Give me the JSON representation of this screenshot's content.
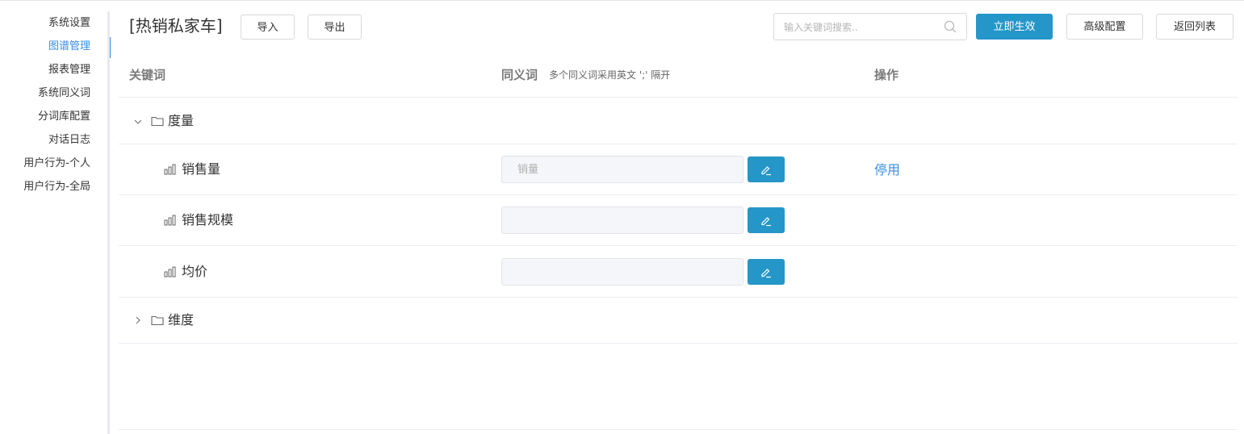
{
  "sidebar": {
    "items": [
      {
        "label": "系统设置",
        "active": false
      },
      {
        "label": "图谱管理",
        "active": true
      },
      {
        "label": "报表管理",
        "active": false
      },
      {
        "label": "系统同义词",
        "active": false
      },
      {
        "label": "分词库配置",
        "active": false
      },
      {
        "label": "对话日志",
        "active": false
      },
      {
        "label": "用户行为-个人",
        "active": false
      },
      {
        "label": "用户行为-全局",
        "active": false
      }
    ]
  },
  "header": {
    "title": "[热销私家车]",
    "import_label": "导入",
    "export_label": "导出",
    "search_placeholder": "输入关键词搜索..",
    "apply_label": "立即生效",
    "advanced_label": "高级配置",
    "back_label": "返回列表"
  },
  "table": {
    "columns": {
      "keyword": "关键词",
      "synonym": "同义词",
      "synonym_hint": "多个同义词采用英文 ';' 隔开",
      "ops": "操作"
    },
    "groups": [
      {
        "label": "度量",
        "expanded": true,
        "items": [
          {
            "label": "销售量",
            "synonym_value": "",
            "synonym_placeholder": "销量",
            "op": "停用"
          },
          {
            "label": "销售规模",
            "synonym_value": "",
            "synonym_placeholder": "",
            "op": ""
          },
          {
            "label": "均价",
            "synonym_value": "",
            "synonym_placeholder": "",
            "op": ""
          }
        ]
      },
      {
        "label": "维度",
        "expanded": false,
        "items": []
      }
    ]
  },
  "colors": {
    "accent": "#2596c8",
    "link": "#3a8ee6",
    "input_bg": "#f4f6f9"
  }
}
